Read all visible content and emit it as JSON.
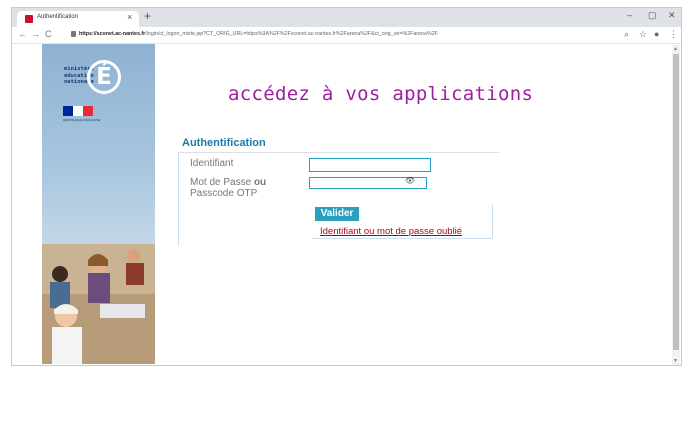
{
  "browser": {
    "tab_title": "Authentification",
    "tab_close": "×",
    "new_tab": "+",
    "window_controls": {
      "minimize": "–",
      "maximize": "▢",
      "close": "✕"
    },
    "nav": {
      "back": "←",
      "forward": "→",
      "reload": "C"
    },
    "url_host": "https://sconet.ac-nantes.fr",
    "url_path": "/login/ct_logon_mixte.jsp?CT_ORIG_URL=https%3A%2F%2Fsconet.ac-nantes.fr%2Farena%2F&ct_orig_uri=%2Farena%2F",
    "toolbar_icons": [
      "zoom-icon",
      "star-icon",
      "account-icon",
      "menu-icon"
    ],
    "toolbar_glyphs": {
      "zoom": "⌕",
      "star": "☆",
      "account": "●",
      "menu": "⋮"
    }
  },
  "sidebar": {
    "ministry_lines": [
      "ministère",
      "éducation",
      "nationale"
    ],
    "logo_letter": "É",
    "flag_caption": "RÉPUBLIQUE FRANÇAISE"
  },
  "main": {
    "headline": "accédez à vos applications",
    "auth_title": "Authentification",
    "identifiant_label": "Identifiant",
    "password_label_prefix": "Mot de Passe",
    "password_label_or": "ou",
    "password_label_line2": "Passcode OTP",
    "eye_glyph": "👁",
    "submit_label": "Valider",
    "forgot_link": "Identifiant ou mot de passe oublié",
    "identifiant_value": "",
    "password_value": ""
  },
  "colors": {
    "headline": "#9d1f9d",
    "title": "#1e7aa8",
    "button": "#2c9fbe",
    "link": "#b0002a",
    "flag_blue": "#002395",
    "flag_red": "#ed2939"
  }
}
